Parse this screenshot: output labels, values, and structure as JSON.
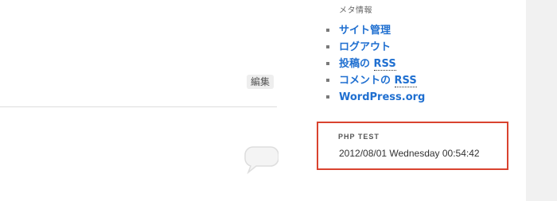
{
  "post": {
    "edit_label": "編集"
  },
  "sidebar": {
    "meta": {
      "title": "メタ情報",
      "items": [
        {
          "label": "サイト管理"
        },
        {
          "label": "ログアウト"
        },
        {
          "label_prefix": "投稿の ",
          "label_abbr": "RSS"
        },
        {
          "label_prefix": "コメントの ",
          "label_abbr": "RSS"
        },
        {
          "label": "WordPress.org"
        }
      ]
    },
    "php_test": {
      "title": "PHP TEST",
      "datetime": "2012/08/01 Wednesday 00:54:42"
    }
  },
  "colors": {
    "link": "#1f6fd0",
    "highlight_border": "#d9432f"
  }
}
